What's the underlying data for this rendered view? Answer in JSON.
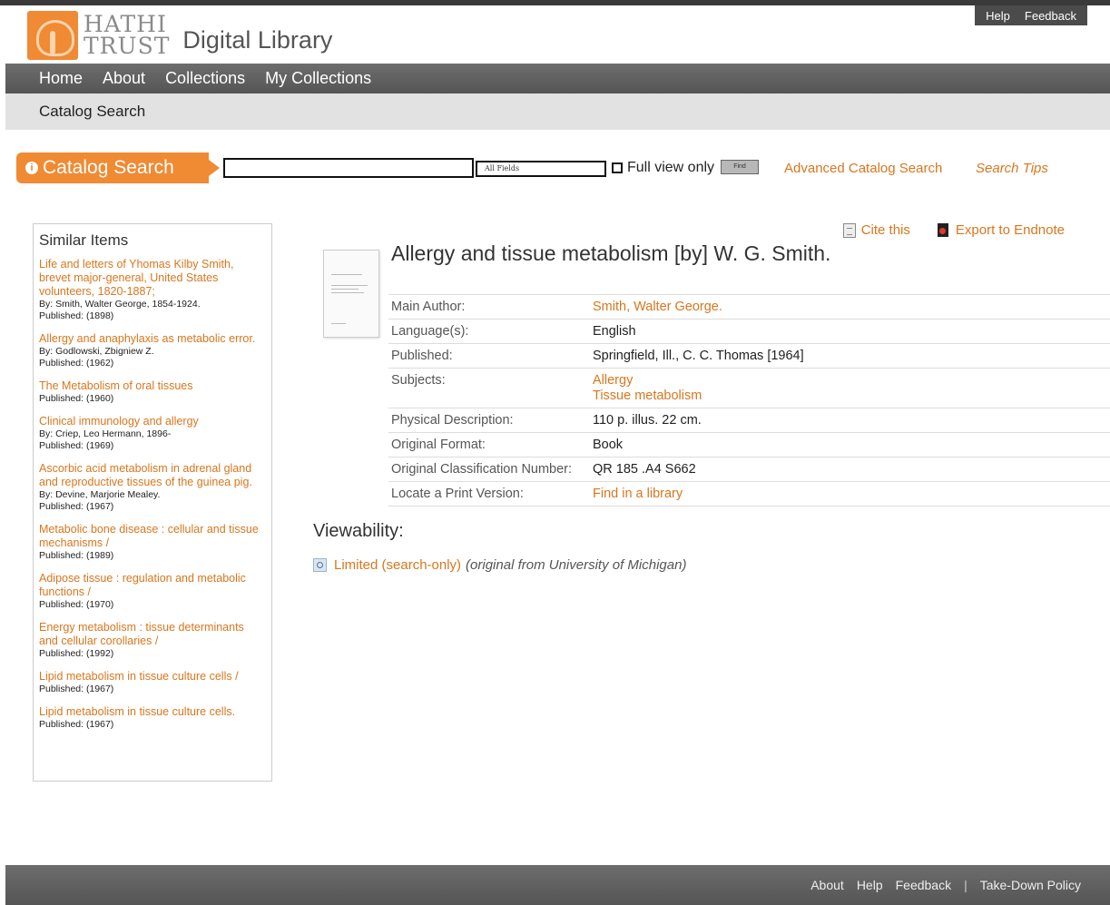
{
  "utility": {
    "help": "Help",
    "feedback": "Feedback"
  },
  "logo": {
    "line1": "HATHI",
    "line2": "TRUST",
    "subtitle": "Digital Library"
  },
  "nav": {
    "items": [
      "Home",
      "About",
      "Collections",
      "My Collections"
    ]
  },
  "subnav": {
    "label": "Catalog Search"
  },
  "search": {
    "label": "Catalog Search",
    "query": "",
    "field_option": "All Fields",
    "full_view_label": "Full view only",
    "find_label": "Find",
    "advanced_link": "Advanced Catalog Search",
    "tips_link": "Search Tips"
  },
  "similar": {
    "heading": "Similar Items",
    "items": [
      {
        "title": "Life and letters of Yhomas Kilby Smith, brevet major-general, United States volunteers, 1820-1887;",
        "author": "By: Smith, Walter George, 1854-1924.",
        "published": "Published: (1898)"
      },
      {
        "title": "Allergy and anaphylaxis as metabolic error.",
        "author": "By: Godlowski, Zbigniew Z.",
        "published": "Published: (1962)"
      },
      {
        "title": "The Metabolism of oral tissues",
        "author": "",
        "published": "Published: (1960)"
      },
      {
        "title": "Clinical immunology and allergy",
        "author": "By: Criep, Leo Hermann, 1896-",
        "published": "Published: (1969)"
      },
      {
        "title": "Ascorbic acid metabolism in adrenal gland and reproductive tissues of the guinea pig.",
        "author": "By: Devine, Marjorie Mealey.",
        "published": "Published: (1967)"
      },
      {
        "title": "Metabolic bone disease : cellular and tissue mechanisms /",
        "author": "",
        "published": "Published: (1989)"
      },
      {
        "title": "Adipose tissue : regulation and metabolic functions /",
        "author": "",
        "published": "Published: (1970)"
      },
      {
        "title": "Energy metabolism : tissue determinants and cellular corollaries /",
        "author": "",
        "published": "Published: (1992)"
      },
      {
        "title": "Lipid metabolism in tissue culture cells /",
        "author": "",
        "published": "Published: (1967)"
      },
      {
        "title": "Lipid metabolism in tissue culture cells.",
        "author": "",
        "published": "Published: (1967)"
      }
    ]
  },
  "tools": {
    "cite": "Cite this",
    "endnote": "Export to Endnote"
  },
  "record": {
    "title": "Allergy and tissue metabolism [by] W. G. Smith.",
    "main_author_label": "Main Author:",
    "main_author": "Smith, Walter George.",
    "language_label": "Language(s):",
    "language": "English",
    "published_label": "Published:",
    "published": "Springfield, Ill., C. C. Thomas [1964]",
    "subjects_label": "Subjects:",
    "subjects": [
      "Allergy",
      "Tissue metabolism"
    ],
    "physical_label": "Physical Description:",
    "physical": "110 p. illus. 22 cm.",
    "format_label": "Original Format:",
    "format": "Book",
    "classification_label": "Original Classification Number:",
    "classification": "QR 185 .A4 S662",
    "locate_label": "Locate a Print Version:",
    "locate": "Find in a library"
  },
  "viewability": {
    "heading": "Viewability:",
    "limited": "Limited (search-only)",
    "origin": "(original from University of Michigan)"
  },
  "footer": {
    "about": "About",
    "help": "Help",
    "feedback": "Feedback",
    "separator": "|",
    "takedown": "Take-Down Policy"
  }
}
